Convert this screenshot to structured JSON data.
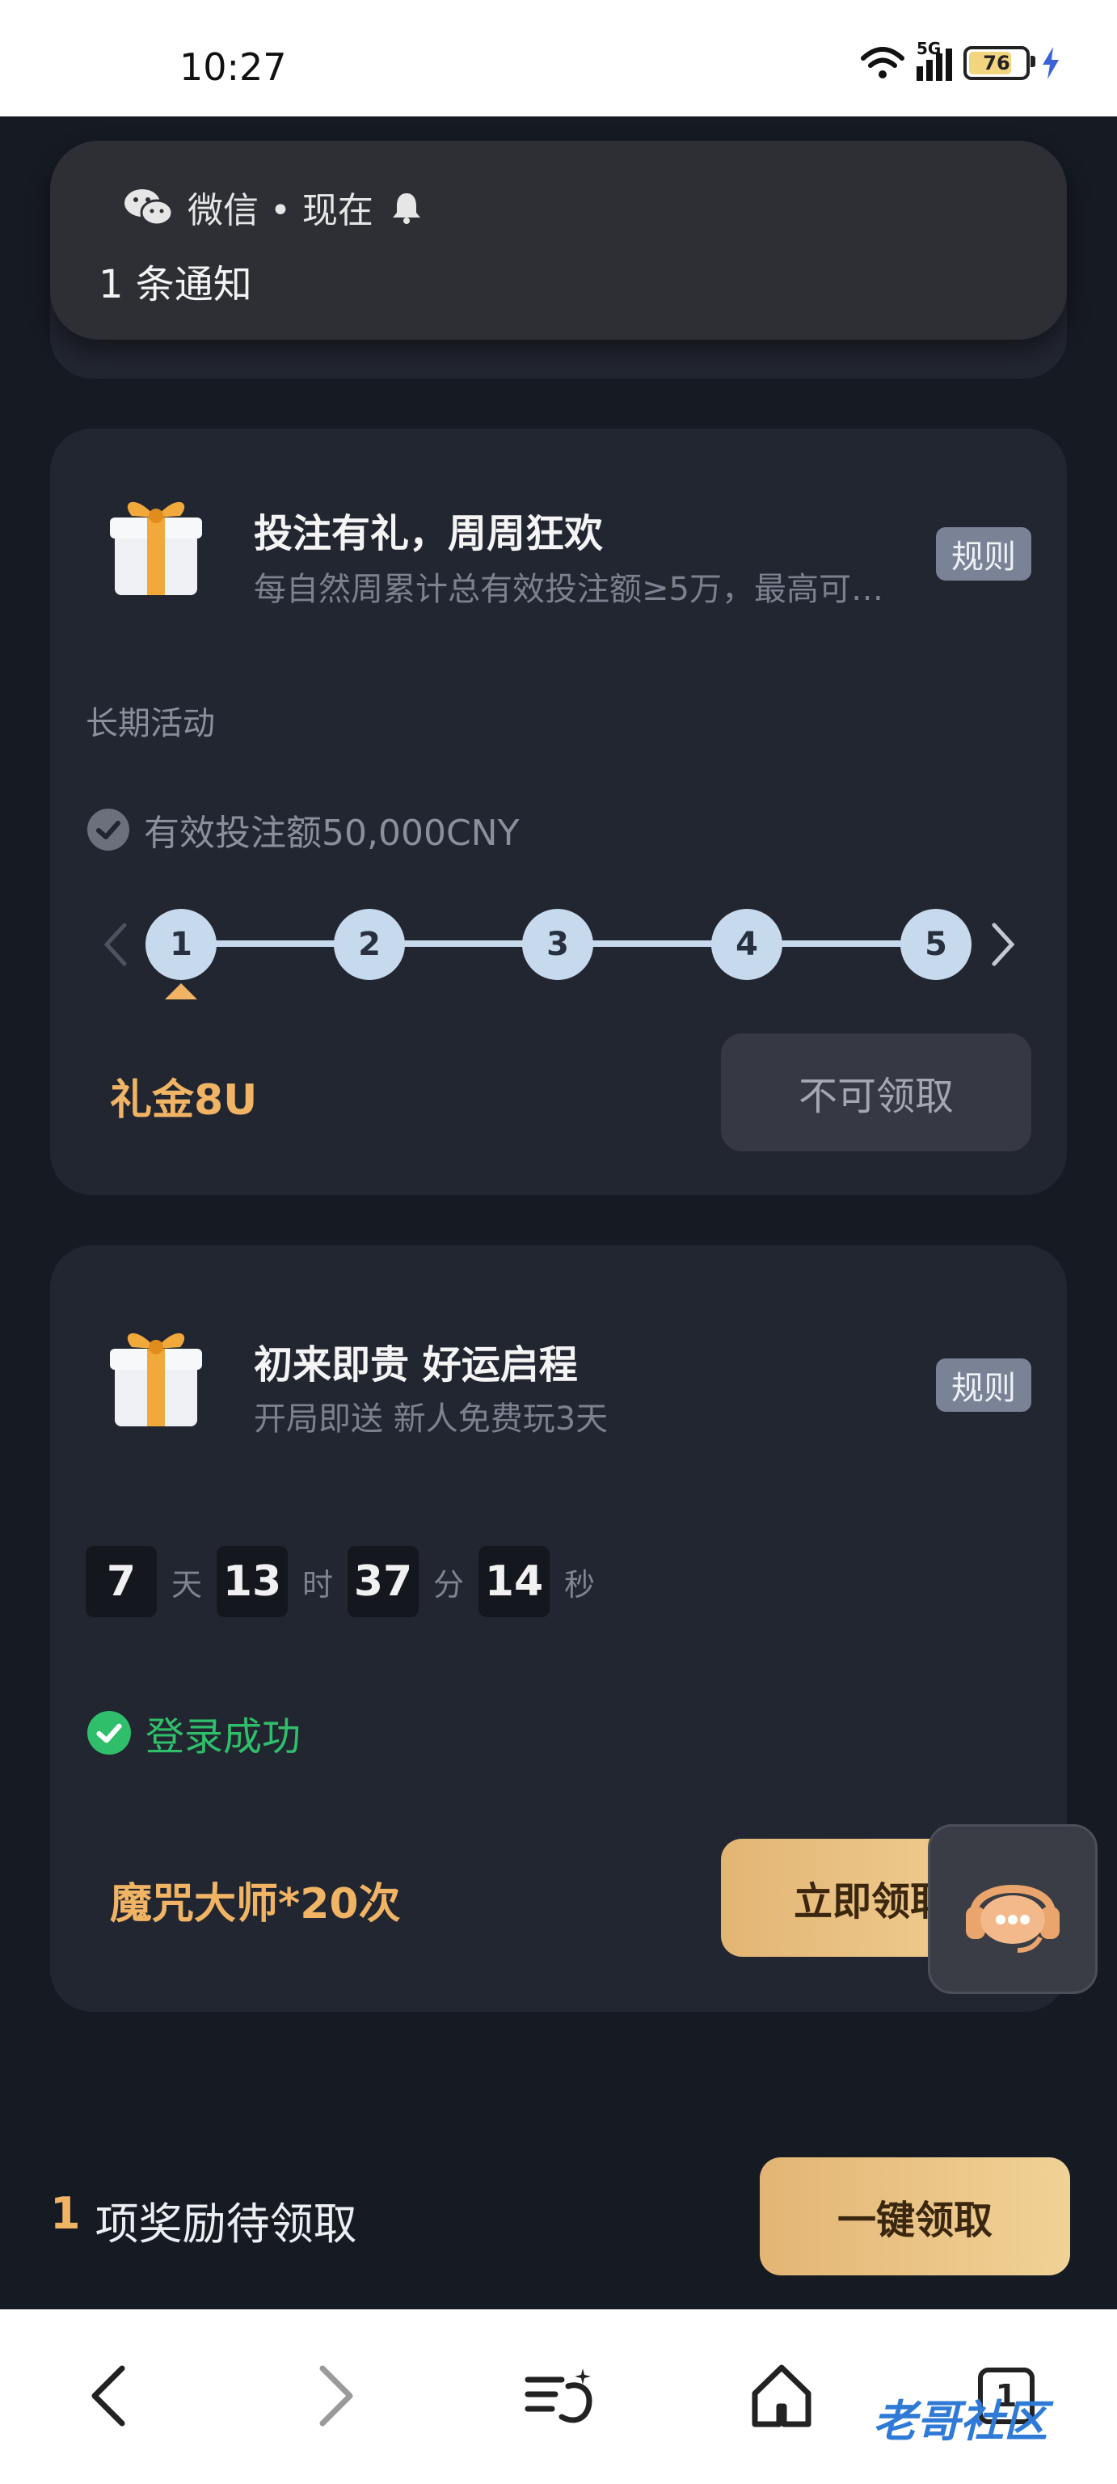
{
  "status_bar": {
    "time": "10:27",
    "network": "5G",
    "battery_level": "76"
  },
  "notification": {
    "app": "微信 • 现在",
    "text": "1 条通知"
  },
  "card1": {
    "title": "投注有礼，周周狂欢",
    "desc": "每自然周累计总有效投注额≥5万，最高可…",
    "rule_label": "规则",
    "tag": "长期活动",
    "condition": "有效投注额50,000CNY",
    "steps": [
      "1",
      "2",
      "3",
      "4",
      "5"
    ],
    "reward": "礼金8U",
    "button": "不可领取"
  },
  "card2": {
    "title": "初来即贵 好运启程",
    "desc": "开局即送 新人免费玩3天",
    "rule_label": "规则",
    "countdown": {
      "days": "7",
      "days_unit": "天",
      "hours": "13",
      "hours_unit": "时",
      "minutes": "37",
      "minutes_unit": "分",
      "seconds": "14",
      "seconds_unit": "秒"
    },
    "status": "登录成功",
    "reward": "魔咒大师*20次",
    "button": "立即领取"
  },
  "footer": {
    "pending_count": "1",
    "pending_text": "项奖励待领取",
    "claim_all": "一键领取"
  },
  "browser_nav": {
    "tab_count": "1"
  },
  "watermark": "老哥社区",
  "colors": {
    "background": "#161a22",
    "card": "#222631",
    "gold": "#f0b464",
    "success": "#2fbf6a",
    "step": "#c7d9ec"
  }
}
